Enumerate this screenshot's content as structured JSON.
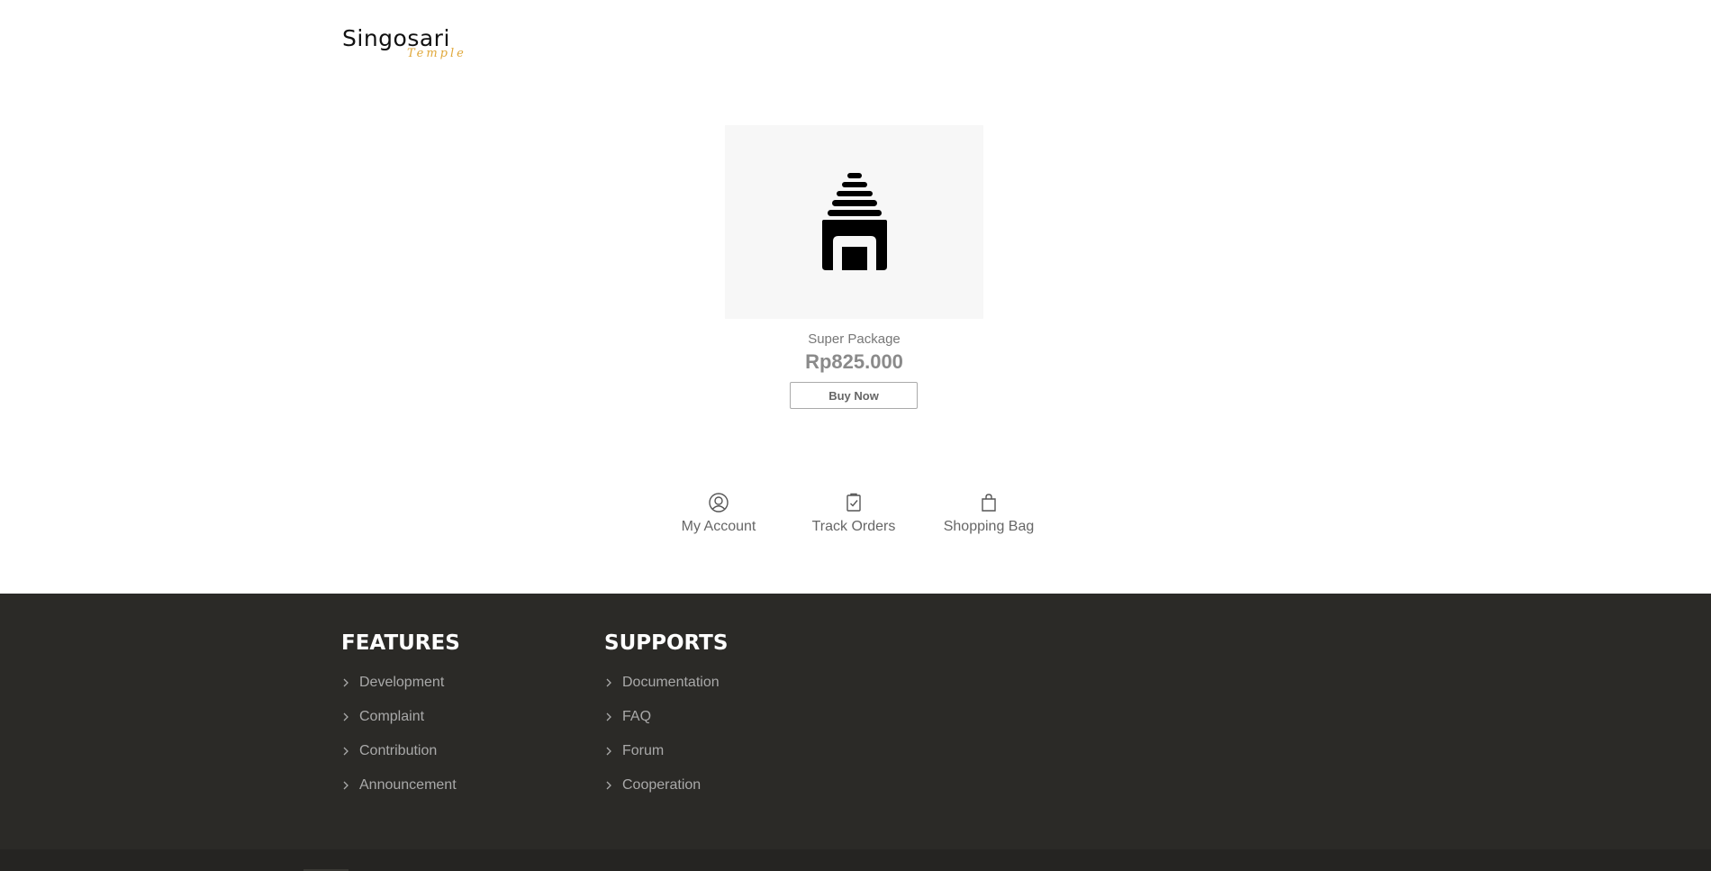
{
  "header": {
    "logo_main": "Singosari",
    "logo_sub": "Temple"
  },
  "product": {
    "name": "Super Package",
    "price": "Rp825.000",
    "buy_label": "Buy Now"
  },
  "quick_links": [
    {
      "label": "My Account",
      "icon": "user-circle-icon"
    },
    {
      "label": "Track Orders",
      "icon": "clipboard-check-icon"
    },
    {
      "label": "Shopping Bag",
      "icon": "shopping-bag-icon"
    }
  ],
  "footer": {
    "features": {
      "heading": "FEATURES",
      "items": [
        "Development",
        "Complaint",
        "Contribution",
        "Announcement"
      ]
    },
    "supports": {
      "heading": "SUPPORTS",
      "items": [
        "Documentation",
        "FAQ",
        "Forum",
        "Cooperation"
      ]
    }
  },
  "colors": {
    "footer_bg": "#2b2a27",
    "logo_accent": "#e0a83a",
    "heading": "#ffffff",
    "link": "#a9a9a9"
  }
}
